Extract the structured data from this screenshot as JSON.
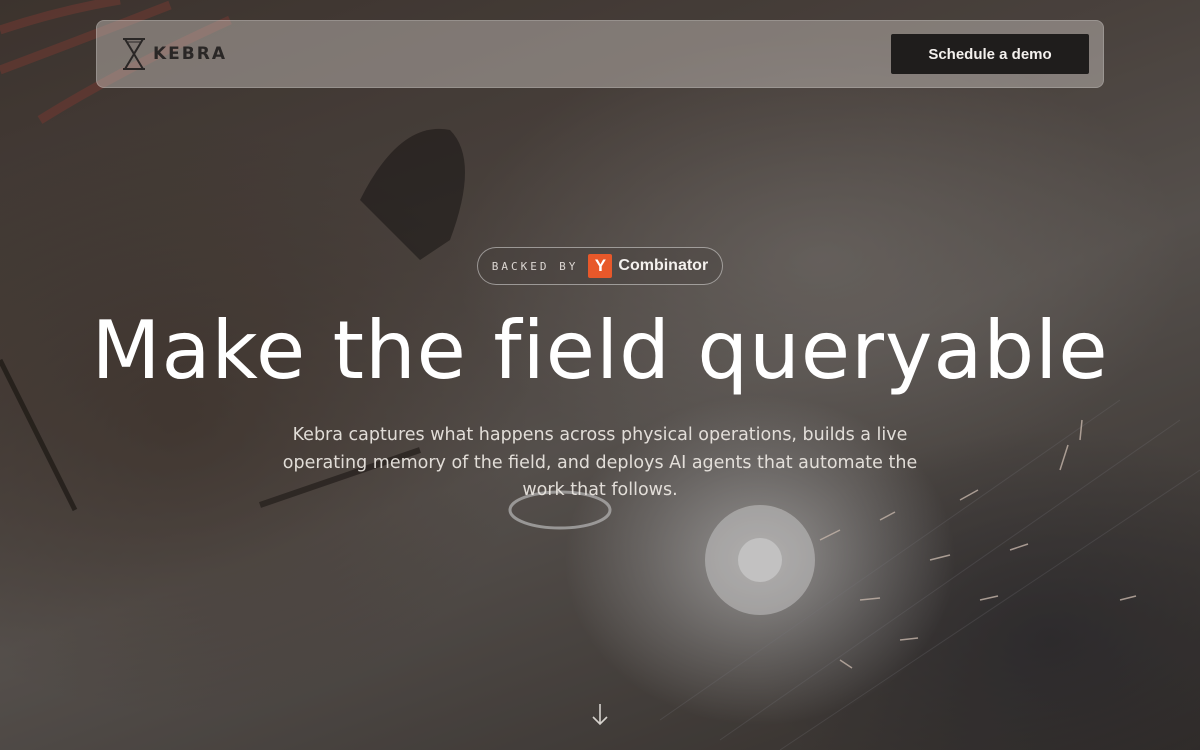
{
  "navbar": {
    "brand_name": "KEBRA",
    "cta_label": "Schedule a demo"
  },
  "badge": {
    "prefix": "BACKED BY",
    "logo_letter": "Y",
    "name": "Combinator",
    "logo_color": "#e8582a"
  },
  "hero": {
    "headline": "Make the field queryable",
    "subheadline": "Kebra captures what happens across physical operations, builds a live operating memory of the field, and deploys AI agents that automate the work that follows."
  },
  "icons": {
    "brand": "hourglass-logo-icon",
    "scroll": "arrow-down-icon"
  },
  "colors": {
    "cta_background": "#1f1d1c",
    "headline": "#ffffff"
  }
}
